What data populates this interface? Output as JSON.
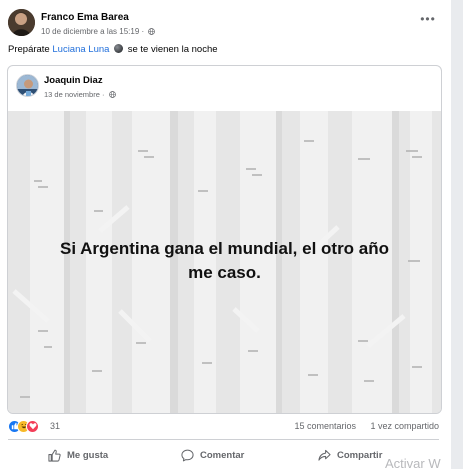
{
  "post": {
    "author": "Franco Ema Barea",
    "timestamp": "10 de diciembre a las 15:19",
    "privacy_icon": "globe-icon",
    "more_label": "•••",
    "text_before": "Prepárate",
    "mention": "Luciana Luna",
    "emoji_icon": "new-moon-icon",
    "text_after": "se te vienen la noche"
  },
  "shared": {
    "author": "Joaquin Diaz",
    "timestamp": "13 de noviembre",
    "meta_separator": "·",
    "privacy_icon": "globe-icon",
    "caption_line1": "Si Argentina gana el mundial, el otro año",
    "caption_line2": "me caso."
  },
  "stats": {
    "reaction_icons": [
      "like-reaction-icon",
      "haha-reaction-icon",
      "love-reaction-icon"
    ],
    "reaction_count": "31",
    "comments": "15 comentarios",
    "shares": "1 vez compartido"
  },
  "actions": {
    "like": "Me gusta",
    "comment": "Comentar",
    "share": "Compartir"
  },
  "overlay": {
    "watermark": "Activar W"
  },
  "colors": {
    "mention": "#216fdb",
    "secondary_text": "#65676b",
    "like_blue": "#1877f2",
    "love_red": "#f33e58",
    "haha_yellow": "#f7b928"
  }
}
